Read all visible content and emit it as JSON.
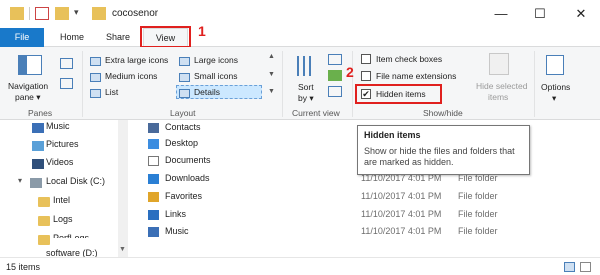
{
  "window": {
    "title": "cocosenor",
    "minimize": "—",
    "maximize": "☐",
    "close": "✕"
  },
  "tabs": [
    "File",
    "Home",
    "Share",
    "View"
  ],
  "annotations": {
    "step1": "1",
    "step2": "2"
  },
  "ribbon": {
    "panes": {
      "navigation_pane": "Navigation",
      "navigation_pane2": "pane ▾",
      "label": "Panes"
    },
    "layout": {
      "label": "Layout",
      "items": [
        "Extra large icons",
        "Large icons",
        "Medium icons",
        "Small icons",
        "List",
        "Details"
      ]
    },
    "current_view": {
      "sort_by": "Sort",
      "sort_by2": "by ▾",
      "label": "Current view"
    },
    "show_hide": {
      "label": "Show/hide",
      "item_check_boxes": "Item check boxes",
      "file_name_extensions": "File name extensions",
      "hidden_items": "Hidden items",
      "hide_selected_items": "Hide selected",
      "hide_selected_items2": "items"
    },
    "options": {
      "label": "Options",
      "arrow": "▾"
    }
  },
  "tooltip": {
    "title": "Hidden items",
    "body": "Show or hide the files and folders that are marked as hidden."
  },
  "nav": {
    "items": [
      "Music",
      "Pictures",
      "Videos",
      "Local Disk (C:)",
      "Intel",
      "Logs",
      "PerfLogs",
      "software (D:)"
    ]
  },
  "files": [
    {
      "name": "Contacts",
      "date": "",
      "type": ""
    },
    {
      "name": "Desktop",
      "date": "",
      "type": ""
    },
    {
      "name": "Documents",
      "date": "",
      "type": ""
    },
    {
      "name": "Downloads",
      "date": "11/10/2017 4:01 PM",
      "type": "File folder"
    },
    {
      "name": "Favorites",
      "date": "11/10/2017 4:01 PM",
      "type": "File folder"
    },
    {
      "name": "Links",
      "date": "11/10/2017 4:01 PM",
      "type": "File folder"
    },
    {
      "name": "Music",
      "date": "11/10/2017 4:01 PM",
      "type": "File folder"
    }
  ],
  "status": {
    "count": "15 items"
  },
  "colors": {
    "accent": "#1979ca",
    "highlight": "#e0201e",
    "folder": "#e8c15a"
  }
}
